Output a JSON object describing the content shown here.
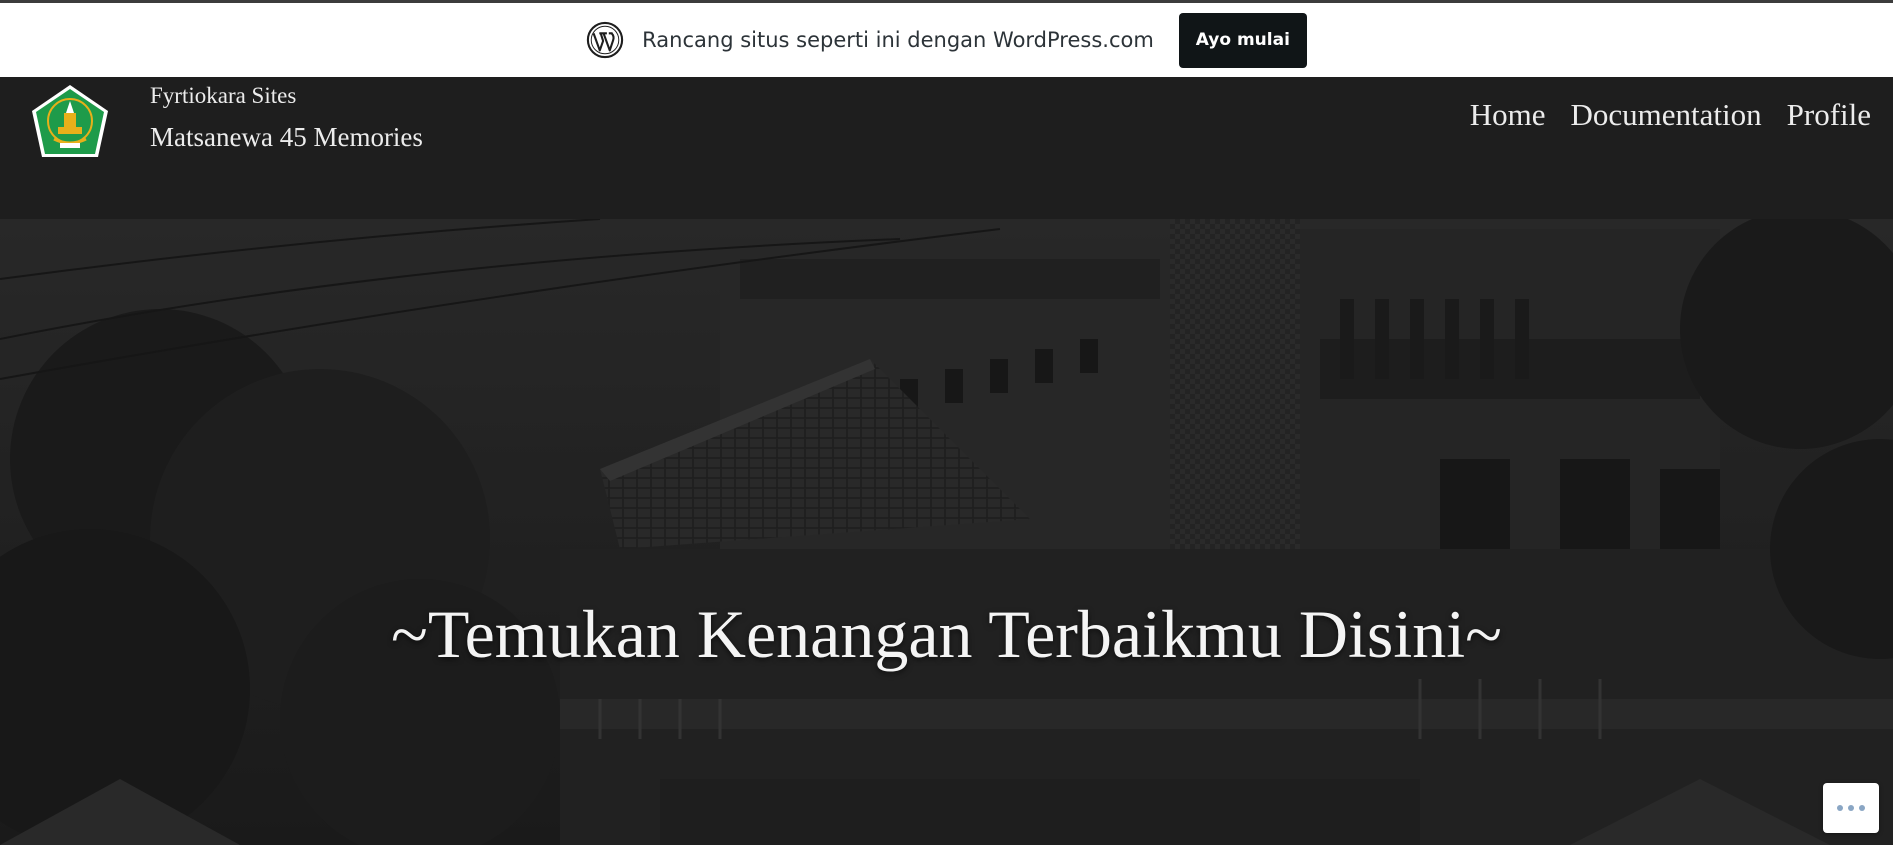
{
  "promo": {
    "icon": "wordpress-logo-icon",
    "text": "Rancang situs seperti ini dengan WordPress.com",
    "button_label": "Ayo mulai"
  },
  "header": {
    "logo_icon": "school-emblem-logo",
    "subtitle": "Fyrtiokara Sites",
    "title": "Matsanewa 45 Memories",
    "nav": [
      {
        "label": "Home"
      },
      {
        "label": "Documentation"
      },
      {
        "label": "Profile"
      }
    ]
  },
  "hero": {
    "heading": "~Temukan Kenangan Terbaikmu Disini~",
    "background": "dark school building photograph"
  },
  "floating": {
    "more_icon": "ellipsis-icon"
  },
  "colors": {
    "header_bg": "#1e1e1e",
    "promo_bg": "#ffffff",
    "promo_button_bg": "#101517",
    "text_light": "#ececec",
    "logo_green": "#1e9b4a",
    "logo_gold": "#e7b01a"
  }
}
